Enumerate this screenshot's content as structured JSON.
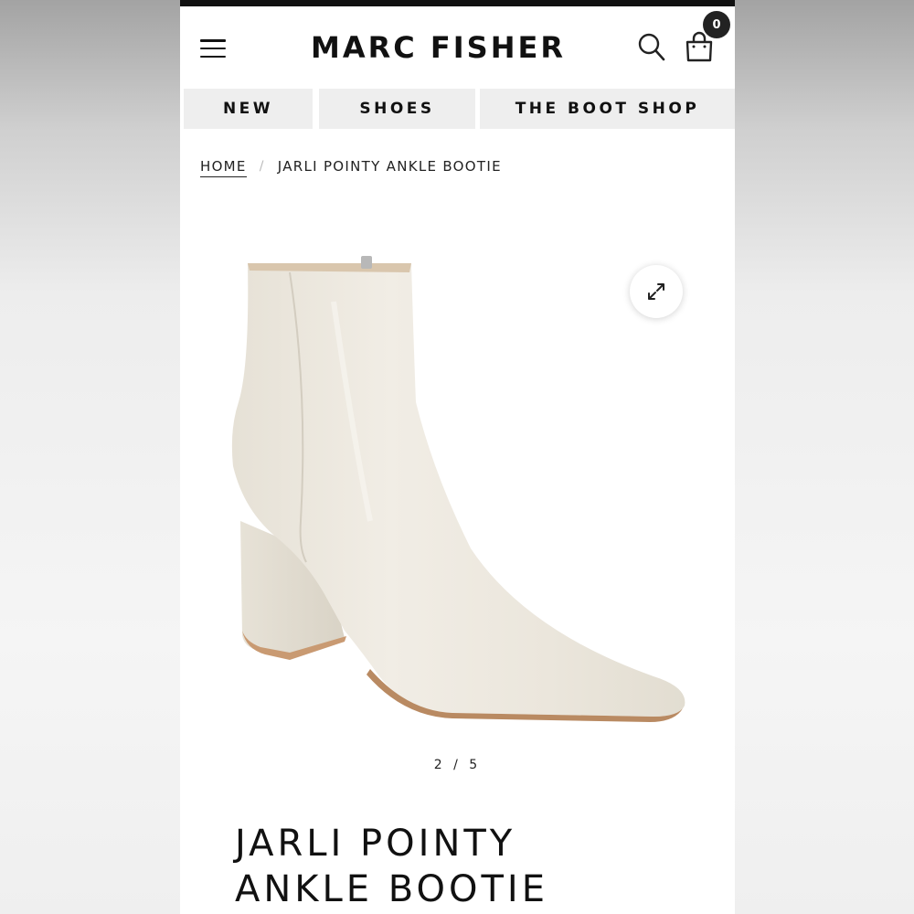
{
  "header": {
    "brand": "MARC FISHER",
    "cart_count": "0"
  },
  "nav": {
    "items": [
      {
        "label": "NEW"
      },
      {
        "label": "SHOES"
      },
      {
        "label": "THE BOOT SHOP"
      }
    ]
  },
  "breadcrumb": {
    "home": "HOME",
    "separator": "/",
    "current": "JARLI POINTY ANKLE BOOTIE"
  },
  "gallery": {
    "pager": "2 / 5",
    "image_subject": "cream leather pointy-toe ankle bootie with block heel"
  },
  "product": {
    "title_line1": "JARLI POINTY",
    "title_line2": "ANKLE BOOTIE"
  },
  "icons": {
    "menu": "hamburger-menu-icon",
    "search": "search-icon",
    "bag": "shopping-bag-icon",
    "expand": "expand-icon"
  },
  "colors": {
    "text": "#111111",
    "nav_bg": "#eeeeee",
    "boot": "#ece8df"
  }
}
